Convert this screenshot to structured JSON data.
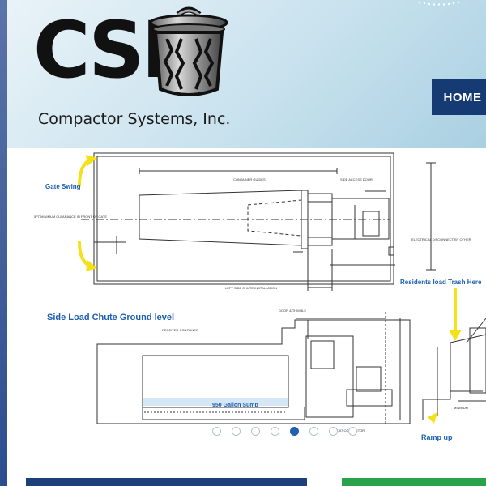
{
  "brand": {
    "letters": "CSI",
    "tagline": "Compactor Systems, Inc."
  },
  "nav": {
    "home_label": "HOME"
  },
  "slide": {
    "gate_swing": "Gate Swing",
    "clearance_note": "5FT MINIMUM CLEARANCE IN FRONT OF GATE",
    "container_guides": "CONTAINER GUIDES",
    "side_access_door": "SIDE ACCESS DOOR",
    "electrical": "ELECTRICAL DISCONNECT BY OTHER",
    "install_caption": "LEFT SIDE CHUTE INSTALLATION",
    "side_load_title": "Side Load Chute Ground level",
    "residents": "Residents load Trash Here",
    "receiver": "RECEIVER CONTAINER",
    "door_thimble": "DOOR & THIMBLE",
    "sump": "950 Gallon Sump",
    "compactor": "CX-07 COMPACTOR",
    "ramp": "Ramp up",
    "minimum": "MINIMUM"
  },
  "carousel": {
    "count": 8,
    "active_index": 4
  },
  "colors": {
    "nav": "#163b74",
    "annotation_blue": "#1f5fb0",
    "arrow_yellow": "#f5e11a",
    "green": "#2aa24a"
  }
}
